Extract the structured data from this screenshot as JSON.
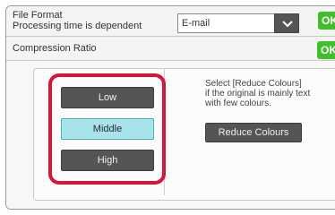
{
  "file_format": {
    "label_line1": "File Format",
    "label_line2": "Processing time is dependent",
    "selected_value": "E-mail",
    "ok_label": "OK"
  },
  "compression": {
    "label": "Compression Ratio",
    "ok_label": "OK",
    "options": [
      "Low",
      "Middle",
      "High"
    ],
    "selected": "Middle"
  },
  "reduce": {
    "info_line1": "Select [Reduce Colours]",
    "info_line2": "if the original is mainly text",
    "info_line3": "with few colours.",
    "button_label": "Reduce Colours"
  },
  "colors": {
    "highlight": "#d7143a",
    "ok_green": "#3fbf2a",
    "selected_fill": "#a7e3ea"
  }
}
